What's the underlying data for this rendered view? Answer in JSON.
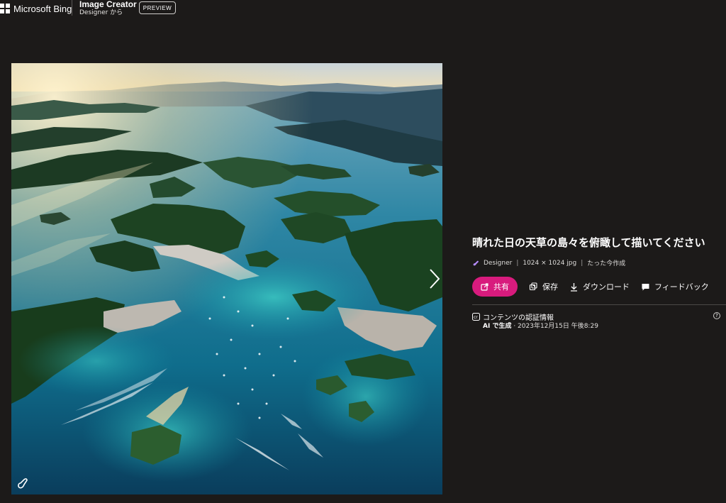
{
  "header": {
    "brand": "Microsoft Bing",
    "app_title": "Image Creator",
    "app_subtitle": "Designer から",
    "badge": "PREVIEW"
  },
  "image": {
    "description_icon": "designer-watermark-icon",
    "next_icon": "chevron-right-icon"
  },
  "details": {
    "prompt_title": "晴れた日の天草の島々を俯瞰して描いてください",
    "meta": {
      "source": "Designer",
      "size": "1024 × 1024 jpg",
      "created": "たった今作成"
    },
    "actions": {
      "share": "共有",
      "save": "保存",
      "download": "ダウンロード",
      "feedback": "フィードバック"
    },
    "credentials": {
      "label": "コンテンツの認証情報",
      "ai_generated": "AI で生成",
      "timestamp": " · 2023年12月15日 午後8:29",
      "help": "?"
    }
  },
  "colors": {
    "background": "#1c1a19",
    "share_button": "#d81b7d"
  }
}
